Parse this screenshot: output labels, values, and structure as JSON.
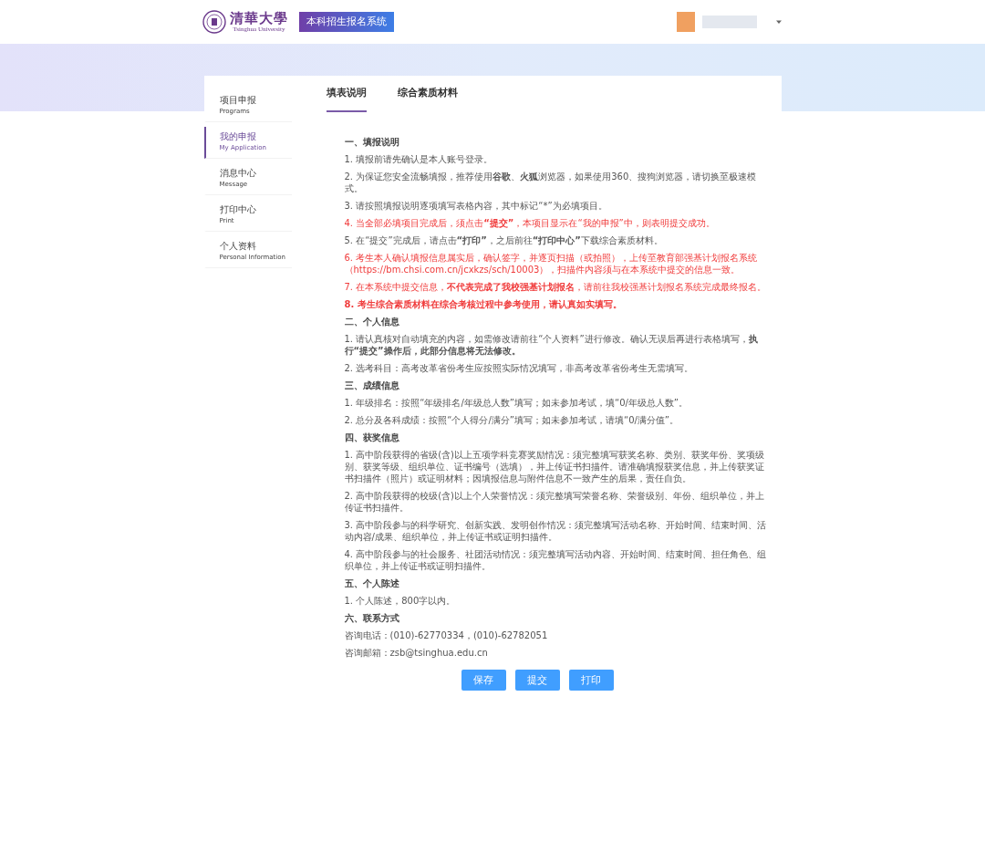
{
  "header": {
    "logo": {
      "name_cn": "清華大學",
      "name_en": "Tsinghua University"
    },
    "system_title": "本科招生报名系统"
  },
  "sidebar": {
    "items": [
      {
        "label": "项目申报",
        "sublabel": "Programs",
        "selected": false
      },
      {
        "label": "我的申报",
        "sublabel": "My Application",
        "selected": true
      },
      {
        "label": "消息中心",
        "sublabel": "Message",
        "selected": false
      },
      {
        "label": "打印中心",
        "sublabel": "Print",
        "selected": false
      },
      {
        "label": "个人资料",
        "sublabel": "Personal Information",
        "selected": false
      }
    ]
  },
  "tabs": [
    {
      "label": "填表说明",
      "selected": true
    },
    {
      "label": "综合素质材料",
      "selected": false
    }
  ],
  "sections": [
    {
      "title": "一、填报说明",
      "items": [
        {
          "kind": "note",
          "text": "1. 填报前请先确认是本人账号登录。"
        },
        {
          "kind": "note",
          "text": "2. 为保证您安全流畅填报，推荐使用**谷歌**、**火狐**浏览器，如果使用360、搜狗浏览器，请切换至极速模式。"
        },
        {
          "kind": "note",
          "text": "3. 请按照填报说明逐项填写表格内容，其中标记“*”为必填项目。"
        },
        {
          "kind": "warning",
          "text": "4. 当全部必填项目完成后，须点击**“提交”**，本项目显示在“我的申报”中，则表明提交成功。"
        },
        {
          "kind": "note",
          "text": "5. 在“提交”完成后，请点击**“打印”**，之后前往**“打印中心”**下载综合素质材料。"
        },
        {
          "kind": "warning",
          "text": "6. 考生本人确认填报信息属实后，确认签字，并逐页扫描（或拍照），上传至教育部强基计划报名系统（https://bm.chsi.com.cn/jcxkzs/sch/10003），扫描件内容须与在本系统中提交的信息一致。"
        },
        {
          "kind": "warning",
          "text": "7. 在本系统中提交信息，**不代表完成了我校强基计划报名**，请前往我校强基计划报名系统完成最终报名。"
        },
        {
          "kind": "warning",
          "text": "**8. 考生综合素质材料在综合考核过程中参考使用，请认真如实填写。**"
        }
      ]
    },
    {
      "title": "二、个人信息",
      "items": [
        {
          "kind": "note",
          "text": "1. 请认真核对自动填充的内容，如需修改请前往“个人资料”进行修改。确认无误后再进行表格填写，**执行“提交”操作后，此部分信息将无法修改。**"
        },
        {
          "kind": "note",
          "text": "2. 选考科目：高考改革省份考生应按照实际情况填写，非高考改革省份考生无需填写。"
        }
      ]
    },
    {
      "title": "三、成绩信息",
      "items": [
        {
          "kind": "note",
          "text": "1. 年级排名：按照“年级排名/年级总人数”填写；如未参加考试，填“0/年级总人数”。"
        },
        {
          "kind": "note",
          "text": "2. 总分及各科成绩：按照“个人得分/满分”填写；如未参加考试，请填“0/满分值”。"
        }
      ]
    },
    {
      "title": "四、获奖信息",
      "items": [
        {
          "kind": "note",
          "text": "1. 高中阶段获得的省级(含)以上五项学科竞赛奖励情况：须完整填写获奖名称、类别、获奖年份、奖项级别、获奖等级、组织单位、证书编号（选填），并上传证书扫描件。请准确填报获奖信息，并上传获奖证书扫描件（照片）或证明材料；因填报信息与附件信息不一致产生的后果，责任自负。"
        },
        {
          "kind": "note",
          "text": "2. 高中阶段获得的校级(含)以上个人荣誉情况：须完整填写荣誉名称、荣誉级别、年份、组织单位，并上传证书扫描件。"
        },
        {
          "kind": "note",
          "text": "3. 高中阶段参与的科学研究、创新实践、发明创作情况：须完整填写活动名称、开始时间、结束时间、活动内容/成果、组织单位，并上传证书或证明扫描件。"
        },
        {
          "kind": "note",
          "text": "4. 高中阶段参与的社会服务、社团活动情况：须完整填写活动内容、开始时间、结束时间、担任角色、组织单位，并上传证书或证明扫描件。"
        }
      ]
    },
    {
      "title": "五、个人陈述",
      "items": [
        {
          "kind": "note",
          "text": "1. 个人陈述，800字以内。"
        }
      ]
    },
    {
      "title": "六、联系方式",
      "items": [
        {
          "kind": "note",
          "text": "咨询电话：(010)-62770334，(010)-62782051"
        },
        {
          "kind": "note",
          "text": "咨询邮箱：zsb@tsinghua.edu.cn"
        }
      ]
    }
  ],
  "buttons": [
    {
      "label": "保存"
    },
    {
      "label": "提交"
    },
    {
      "label": "打印"
    }
  ]
}
